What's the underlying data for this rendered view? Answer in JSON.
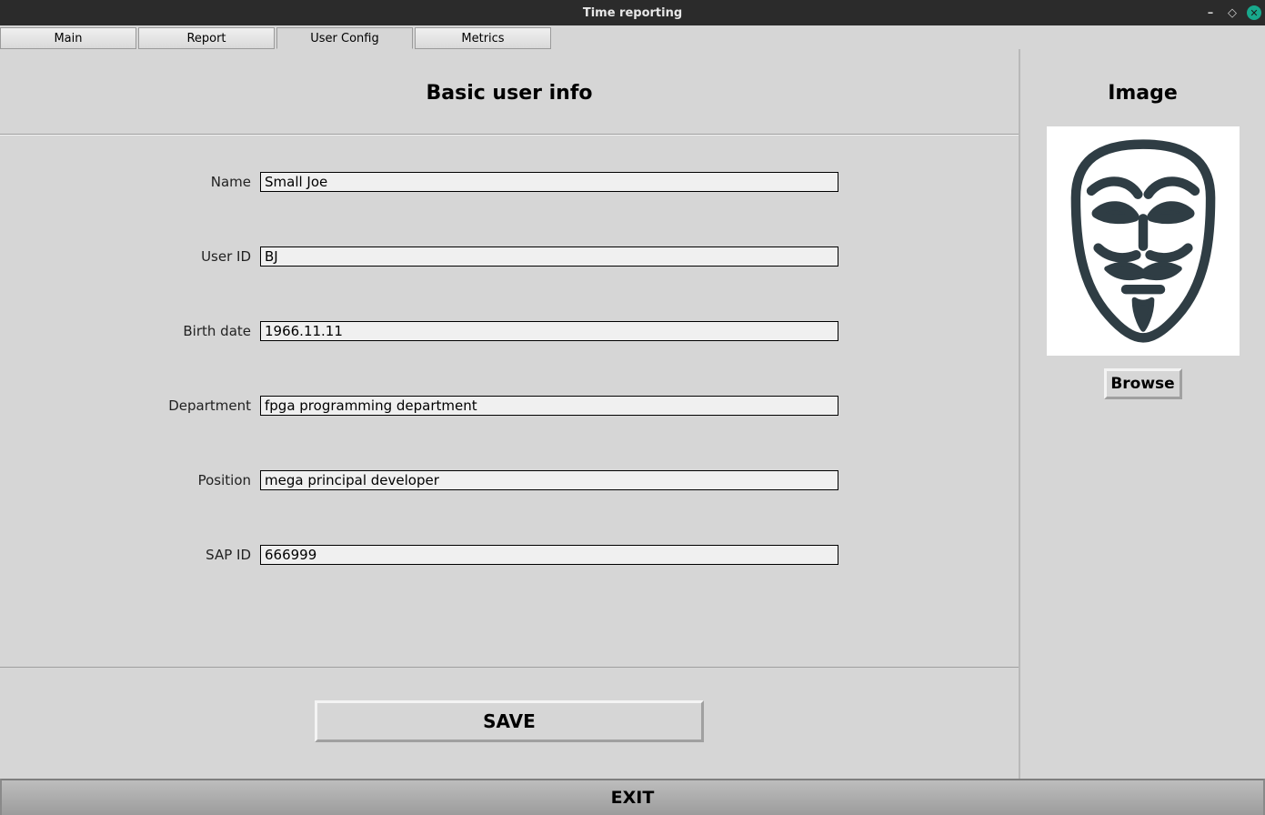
{
  "window": {
    "title": "Time reporting"
  },
  "tabs": {
    "items": [
      "Main",
      "Report",
      "User Config",
      "Metrics"
    ],
    "active_index": 2
  },
  "form_panel": {
    "title": "Basic user info",
    "fields": [
      {
        "label": "Name",
        "value": "Small Joe"
      },
      {
        "label": "User ID",
        "value": "BJ"
      },
      {
        "label": "Birth date",
        "value": "1966.11.11"
      },
      {
        "label": "Department",
        "value": "fpga programming department"
      },
      {
        "label": "Position",
        "value": "mega principal developer"
      },
      {
        "label": "SAP ID",
        "value": "666999"
      }
    ],
    "save_label": "SAVE"
  },
  "image_panel": {
    "title": "Image",
    "avatar": "anonymous-mask-icon",
    "browse_label": "Browse"
  },
  "exit_label": "EXIT",
  "colors": {
    "panel_bg": "#d6d6d6",
    "titlebar_bg": "#2b2b2b",
    "close_btn": "#18a88c",
    "ink": "#2f3d44"
  }
}
